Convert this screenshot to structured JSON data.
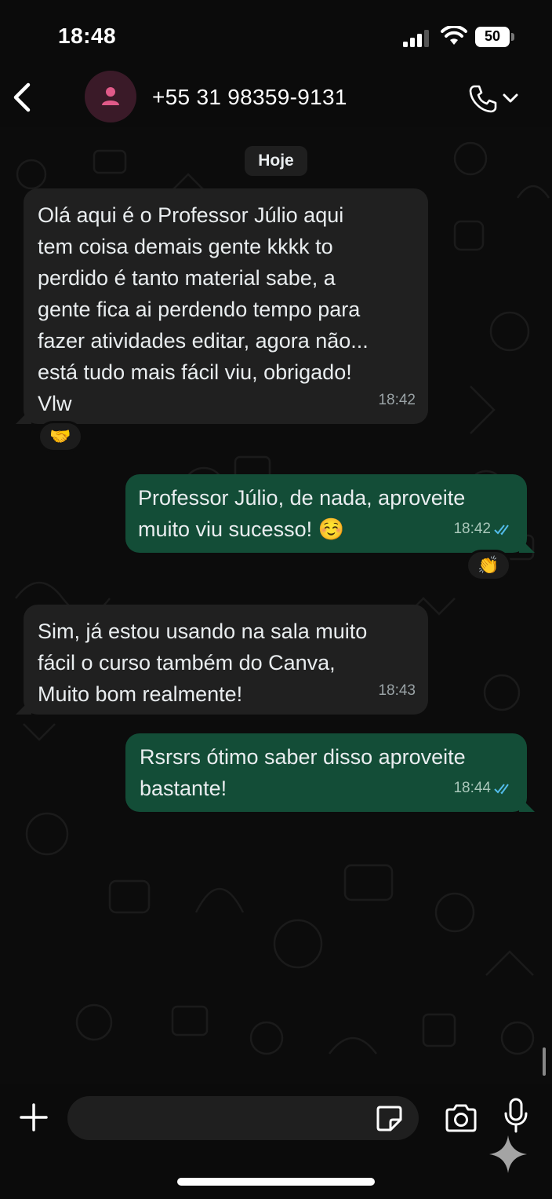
{
  "status_bar": {
    "time": "18:48",
    "battery": "50",
    "icons": [
      "signal-icon",
      "wifi-icon",
      "battery-icon"
    ]
  },
  "header": {
    "contact_name": "+55 31 98359-9131",
    "icons": [
      "back-icon",
      "avatar-person-icon",
      "call-icon",
      "chevron-down-icon"
    ]
  },
  "chat": {
    "date_label": "Hoje",
    "messages": [
      {
        "direction": "incoming",
        "text": "Olá aqui é o Professor Júlio aqui\ntem coisa demais gente kkkk to\nperdido é tanto material sabe, a\ngente fica ai perdendo tempo para\nfazer atividades editar, agora não...\nestá tudo mais fácil viu, obrigado!\nVlw",
        "time": "18:42",
        "reaction": "🤝"
      },
      {
        "direction": "outgoing",
        "text": "Professor Júlio, de nada, aproveite\nmuito viu sucesso! ☺️",
        "time": "18:42",
        "status": "read",
        "reaction": "👏"
      },
      {
        "direction": "incoming",
        "text": "Sim, já estou usando na sala muito\nfácil o curso também do Canva,\nMuito bom realmente!",
        "time": "18:43"
      },
      {
        "direction": "outgoing",
        "text": "Rsrsrs ótimo saber disso aproveite\nbastante!",
        "time": "18:44",
        "status": "read"
      }
    ]
  },
  "input_bar": {
    "message_value": "",
    "icons": [
      "plus-icon",
      "sticker-icon",
      "camera-icon",
      "mic-icon",
      "sparkle-icon"
    ]
  },
  "colors": {
    "background": "#0b0b0b",
    "incoming_bubble": "#202020",
    "outgoing_bubble": "#134d37",
    "read_tick": "#53bdeb",
    "text": "#e9edef"
  }
}
